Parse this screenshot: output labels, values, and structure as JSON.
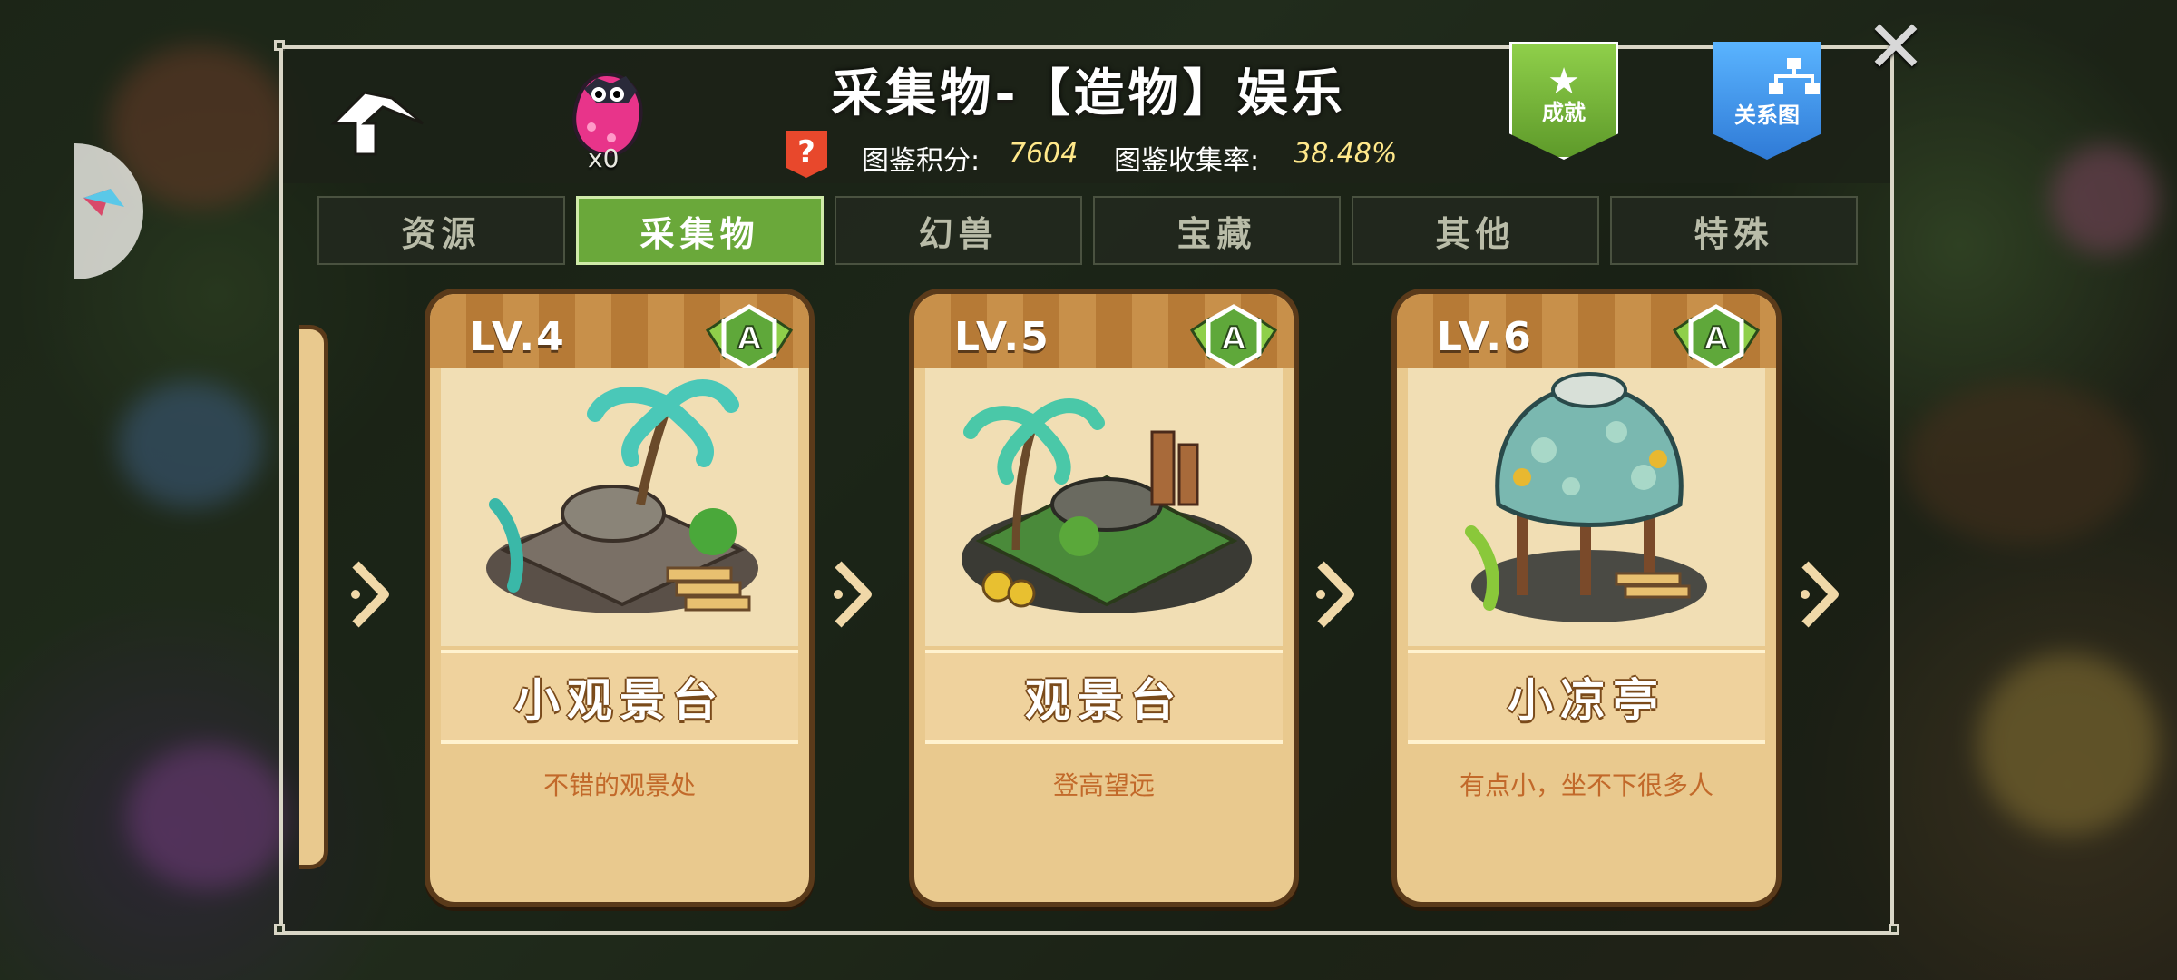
{
  "header": {
    "title": "采集物-【造物】娱乐",
    "mascot_count": "x0",
    "help_label": "?",
    "score_label": "图鉴积分:",
    "score_value": "7604",
    "rate_label": "图鉴收集率:",
    "rate_value": "38.48%",
    "achievement_label": "成就",
    "relation_label": "关系图",
    "close_label": "✕"
  },
  "tabs": [
    {
      "label": "资源",
      "active": false
    },
    {
      "label": "采集物",
      "active": true
    },
    {
      "label": "幻兽",
      "active": false
    },
    {
      "label": "宝藏",
      "active": false
    },
    {
      "label": "其他",
      "active": false
    },
    {
      "label": "特殊",
      "active": false
    }
  ],
  "cards": [
    {
      "level": "LV.4",
      "grade": "A",
      "name": "小观景台",
      "desc": "不错的观景处",
      "image": "small-viewing-platform"
    },
    {
      "level": "LV.5",
      "grade": "A",
      "name": "观景台",
      "desc": "登高望远",
      "image": "viewing-platform"
    },
    {
      "level": "LV.6",
      "grade": "A",
      "name": "小凉亭",
      "desc": "有点小，坐不下很多人",
      "image": "small-pavilion"
    }
  ],
  "colors": {
    "active_tab": "#6aa83a",
    "card_bg": "#e9c98e",
    "card_border": "#5a3a1a",
    "desc_text": "#c2692a",
    "score_value": "#ffe88a",
    "grade_badge": "#5fa83a"
  }
}
